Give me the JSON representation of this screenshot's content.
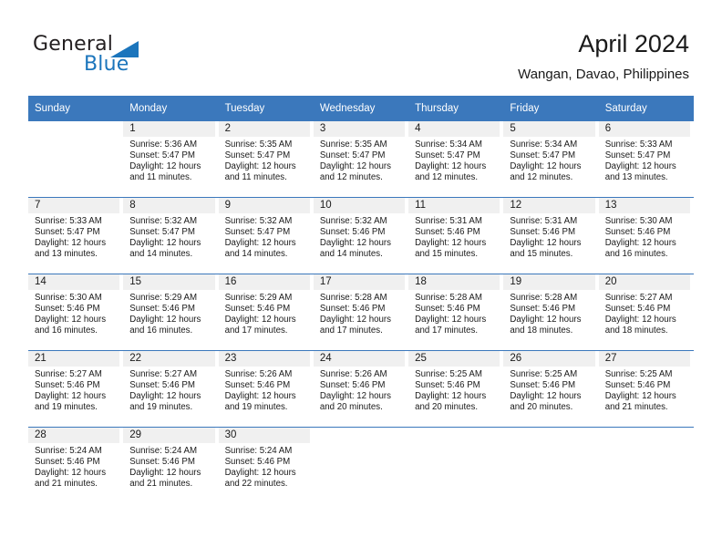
{
  "brand": {
    "name_part1": "General",
    "name_part2": "Blue",
    "triangle_icon": "triangle-icon",
    "accent_color": "#1b75bc"
  },
  "header": {
    "title": "April 2024",
    "subtitle": "Wangan, Davao, Philippines"
  },
  "theme": {
    "header_row_bg": "#3b78bc",
    "header_row_text": "#ffffff",
    "daynum_band_bg": "#f0f0f0",
    "row_separator": "#3b78bc",
    "cell_bg": "#ffffff",
    "text": "#1a1a1a"
  },
  "calendar": {
    "weekday_headers": [
      "Sunday",
      "Monday",
      "Tuesday",
      "Wednesday",
      "Thursday",
      "Friday",
      "Saturday"
    ],
    "labels": {
      "sunrise": "Sunrise:",
      "sunset": "Sunset:",
      "daylight": "Daylight:"
    },
    "weeks": [
      [
        {
          "day": "",
          "sunrise": "",
          "sunset": "",
          "daylight_line1": "",
          "daylight_line2": ""
        },
        {
          "day": "1",
          "sunrise": "Sunrise: 5:36 AM",
          "sunset": "Sunset: 5:47 PM",
          "daylight_line1": "Daylight: 12 hours",
          "daylight_line2": "and 11 minutes."
        },
        {
          "day": "2",
          "sunrise": "Sunrise: 5:35 AM",
          "sunset": "Sunset: 5:47 PM",
          "daylight_line1": "Daylight: 12 hours",
          "daylight_line2": "and 11 minutes."
        },
        {
          "day": "3",
          "sunrise": "Sunrise: 5:35 AM",
          "sunset": "Sunset: 5:47 PM",
          "daylight_line1": "Daylight: 12 hours",
          "daylight_line2": "and 12 minutes."
        },
        {
          "day": "4",
          "sunrise": "Sunrise: 5:34 AM",
          "sunset": "Sunset: 5:47 PM",
          "daylight_line1": "Daylight: 12 hours",
          "daylight_line2": "and 12 minutes."
        },
        {
          "day": "5",
          "sunrise": "Sunrise: 5:34 AM",
          "sunset": "Sunset: 5:47 PM",
          "daylight_line1": "Daylight: 12 hours",
          "daylight_line2": "and 12 minutes."
        },
        {
          "day": "6",
          "sunrise": "Sunrise: 5:33 AM",
          "sunset": "Sunset: 5:47 PM",
          "daylight_line1": "Daylight: 12 hours",
          "daylight_line2": "and 13 minutes."
        }
      ],
      [
        {
          "day": "7",
          "sunrise": "Sunrise: 5:33 AM",
          "sunset": "Sunset: 5:47 PM",
          "daylight_line1": "Daylight: 12 hours",
          "daylight_line2": "and 13 minutes."
        },
        {
          "day": "8",
          "sunrise": "Sunrise: 5:32 AM",
          "sunset": "Sunset: 5:47 PM",
          "daylight_line1": "Daylight: 12 hours",
          "daylight_line2": "and 14 minutes."
        },
        {
          "day": "9",
          "sunrise": "Sunrise: 5:32 AM",
          "sunset": "Sunset: 5:47 PM",
          "daylight_line1": "Daylight: 12 hours",
          "daylight_line2": "and 14 minutes."
        },
        {
          "day": "10",
          "sunrise": "Sunrise: 5:32 AM",
          "sunset": "Sunset: 5:46 PM",
          "daylight_line1": "Daylight: 12 hours",
          "daylight_line2": "and 14 minutes."
        },
        {
          "day": "11",
          "sunrise": "Sunrise: 5:31 AM",
          "sunset": "Sunset: 5:46 PM",
          "daylight_line1": "Daylight: 12 hours",
          "daylight_line2": "and 15 minutes."
        },
        {
          "day": "12",
          "sunrise": "Sunrise: 5:31 AM",
          "sunset": "Sunset: 5:46 PM",
          "daylight_line1": "Daylight: 12 hours",
          "daylight_line2": "and 15 minutes."
        },
        {
          "day": "13",
          "sunrise": "Sunrise: 5:30 AM",
          "sunset": "Sunset: 5:46 PM",
          "daylight_line1": "Daylight: 12 hours",
          "daylight_line2": "and 16 minutes."
        }
      ],
      [
        {
          "day": "14",
          "sunrise": "Sunrise: 5:30 AM",
          "sunset": "Sunset: 5:46 PM",
          "daylight_line1": "Daylight: 12 hours",
          "daylight_line2": "and 16 minutes."
        },
        {
          "day": "15",
          "sunrise": "Sunrise: 5:29 AM",
          "sunset": "Sunset: 5:46 PM",
          "daylight_line1": "Daylight: 12 hours",
          "daylight_line2": "and 16 minutes."
        },
        {
          "day": "16",
          "sunrise": "Sunrise: 5:29 AM",
          "sunset": "Sunset: 5:46 PM",
          "daylight_line1": "Daylight: 12 hours",
          "daylight_line2": "and 17 minutes."
        },
        {
          "day": "17",
          "sunrise": "Sunrise: 5:28 AM",
          "sunset": "Sunset: 5:46 PM",
          "daylight_line1": "Daylight: 12 hours",
          "daylight_line2": "and 17 minutes."
        },
        {
          "day": "18",
          "sunrise": "Sunrise: 5:28 AM",
          "sunset": "Sunset: 5:46 PM",
          "daylight_line1": "Daylight: 12 hours",
          "daylight_line2": "and 17 minutes."
        },
        {
          "day": "19",
          "sunrise": "Sunrise: 5:28 AM",
          "sunset": "Sunset: 5:46 PM",
          "daylight_line1": "Daylight: 12 hours",
          "daylight_line2": "and 18 minutes."
        },
        {
          "day": "20",
          "sunrise": "Sunrise: 5:27 AM",
          "sunset": "Sunset: 5:46 PM",
          "daylight_line1": "Daylight: 12 hours",
          "daylight_line2": "and 18 minutes."
        }
      ],
      [
        {
          "day": "21",
          "sunrise": "Sunrise: 5:27 AM",
          "sunset": "Sunset: 5:46 PM",
          "daylight_line1": "Daylight: 12 hours",
          "daylight_line2": "and 19 minutes."
        },
        {
          "day": "22",
          "sunrise": "Sunrise: 5:27 AM",
          "sunset": "Sunset: 5:46 PM",
          "daylight_line1": "Daylight: 12 hours",
          "daylight_line2": "and 19 minutes."
        },
        {
          "day": "23",
          "sunrise": "Sunrise: 5:26 AM",
          "sunset": "Sunset: 5:46 PM",
          "daylight_line1": "Daylight: 12 hours",
          "daylight_line2": "and 19 minutes."
        },
        {
          "day": "24",
          "sunrise": "Sunrise: 5:26 AM",
          "sunset": "Sunset: 5:46 PM",
          "daylight_line1": "Daylight: 12 hours",
          "daylight_line2": "and 20 minutes."
        },
        {
          "day": "25",
          "sunrise": "Sunrise: 5:25 AM",
          "sunset": "Sunset: 5:46 PM",
          "daylight_line1": "Daylight: 12 hours",
          "daylight_line2": "and 20 minutes."
        },
        {
          "day": "26",
          "sunrise": "Sunrise: 5:25 AM",
          "sunset": "Sunset: 5:46 PM",
          "daylight_line1": "Daylight: 12 hours",
          "daylight_line2": "and 20 minutes."
        },
        {
          "day": "27",
          "sunrise": "Sunrise: 5:25 AM",
          "sunset": "Sunset: 5:46 PM",
          "daylight_line1": "Daylight: 12 hours",
          "daylight_line2": "and 21 minutes."
        }
      ],
      [
        {
          "day": "28",
          "sunrise": "Sunrise: 5:24 AM",
          "sunset": "Sunset: 5:46 PM",
          "daylight_line1": "Daylight: 12 hours",
          "daylight_line2": "and 21 minutes."
        },
        {
          "day": "29",
          "sunrise": "Sunrise: 5:24 AM",
          "sunset": "Sunset: 5:46 PM",
          "daylight_line1": "Daylight: 12 hours",
          "daylight_line2": "and 21 minutes."
        },
        {
          "day": "30",
          "sunrise": "Sunrise: 5:24 AM",
          "sunset": "Sunset: 5:46 PM",
          "daylight_line1": "Daylight: 12 hours",
          "daylight_line2": "and 22 minutes."
        },
        {
          "day": "",
          "sunrise": "",
          "sunset": "",
          "daylight_line1": "",
          "daylight_line2": ""
        },
        {
          "day": "",
          "sunrise": "",
          "sunset": "",
          "daylight_line1": "",
          "daylight_line2": ""
        },
        {
          "day": "",
          "sunrise": "",
          "sunset": "",
          "daylight_line1": "",
          "daylight_line2": ""
        },
        {
          "day": "",
          "sunrise": "",
          "sunset": "",
          "daylight_line1": "",
          "daylight_line2": ""
        }
      ]
    ]
  }
}
